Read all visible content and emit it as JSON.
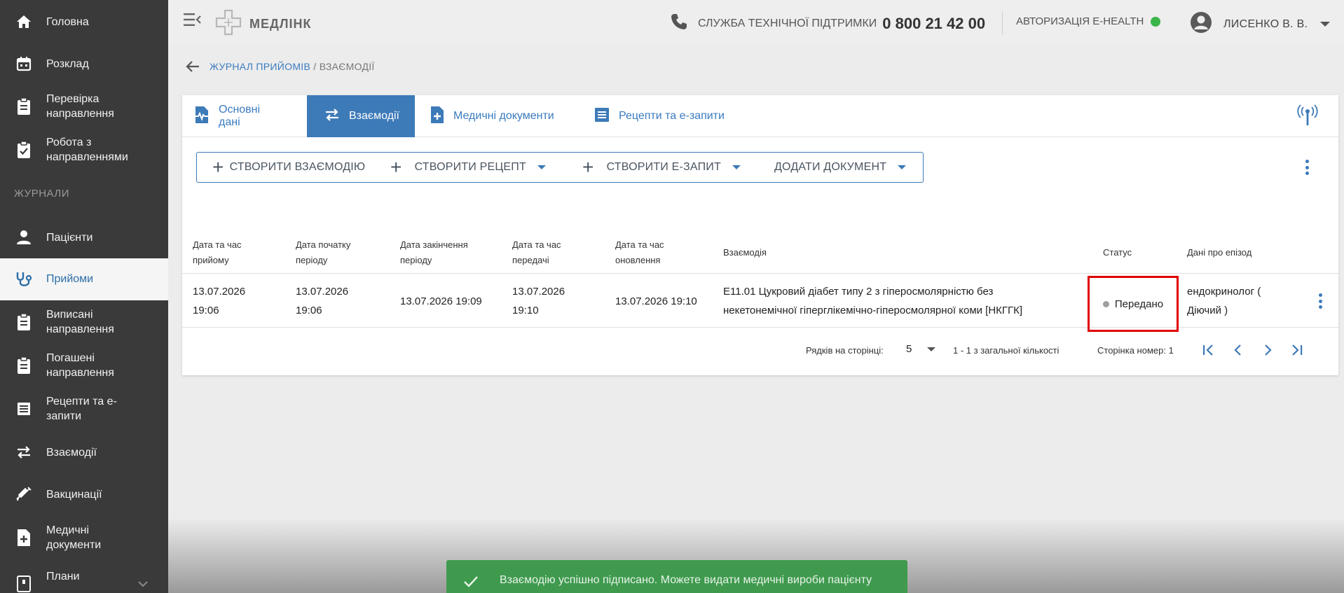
{
  "sidebar": {
    "items": [
      {
        "label": "Головна",
        "icon": "home-icon"
      },
      {
        "label": "Розклад",
        "icon": "calendar-icon"
      },
      {
        "label": "Перевірка\nнаправлення",
        "icon": "clipboard-icon"
      },
      {
        "label": "Робота з\nнаправленнями",
        "icon": "clipboard-check-icon"
      },
      {
        "label": "Пацієнти",
        "icon": "person-icon"
      },
      {
        "label": "Прийоми",
        "icon": "stethoscope-icon"
      },
      {
        "label": "Виписані\nнаправлення",
        "icon": "clipboard-icon"
      },
      {
        "label": "Погашені\nнаправлення",
        "icon": "clipboard-icon"
      },
      {
        "label": "Рецепти та е-\nзапити",
        "icon": "list-icon"
      },
      {
        "label": "Взаємодії",
        "icon": "swap-icon"
      },
      {
        "label": "Вакцинації",
        "icon": "syringe-icon"
      },
      {
        "label": "Медичні\nдокументи",
        "icon": "document-plus-icon"
      },
      {
        "label": "Плани",
        "icon": "plan-icon"
      }
    ],
    "section_label": "ЖУРНАЛИ"
  },
  "topbar": {
    "logo": "МЕДЛІНК",
    "support_label": "СЛУЖБА ТЕХНІЧНОЇ ПІДТРИМКИ",
    "support_phone": "0 800 21 42 00",
    "ehealth_label": "АВТОРИЗАЦІЯ E-HEALTH",
    "ehealth_status_color": "#3bb54a",
    "user_name": "ЛИСЕНКО В. В."
  },
  "breadcrumb": {
    "link": "ЖУРНАЛ ПРИЙОМІВ",
    "separator": " / ",
    "current": "ВЗАЄМОДІЇ"
  },
  "tabs": [
    {
      "label": "Основні дані",
      "icon": "pulse-icon"
    },
    {
      "label": "Взаємодії",
      "icon": "swap-icon"
    },
    {
      "label": "Медичні документи",
      "icon": "document-plus-icon"
    },
    {
      "label": "Рецепти та е-запити",
      "icon": "list-icon"
    }
  ],
  "actions": {
    "create_interaction": "СТВОРИТИ ВЗАЄМОДІЮ",
    "create_prescription": "СТВОРИТИ РЕЦЕПТ",
    "create_erequest": "СТВОРИТИ Е-ЗАПИТ",
    "add_document": "ДОДАТИ ДОКУМЕНТ"
  },
  "table": {
    "headers": [
      "Дата та час\nприйому",
      "Дата початку\nперіоду",
      "Дата закінчення\nперіоду",
      "Дата та час\nпередачі",
      "Дата та час\nоновлення",
      "Взаємодія",
      "Статус",
      "Дані про епізод"
    ],
    "rows": [
      {
        "appointment": "13.07.2026\n19:06",
        "period_start": "13.07.2026\n19:06",
        "period_end": "13.07.2026 19:09",
        "transferred": "13.07.2026\n19:10",
        "updated": "13.07.2026 19:10",
        "interaction": "E11.01 Цукровий діабет типу 2 з гіперосмолярністю без\nнекетонемічної гіперглікемічно-гіперосмолярної коми [НКГГК]",
        "status": "Передано",
        "episode": "ендокринолог (\nДіючий )"
      }
    ]
  },
  "pagination": {
    "rows_per_page_label": "Рядків на сторінці:",
    "rows_per_page": "5",
    "range": "1 - 1 з загальної кількості",
    "page_label": "Сторінка номер: 1"
  },
  "toast": {
    "message": "Взаємодію успішно підписано. Можете видати медичні вироби пацієнту"
  },
  "colors": {
    "sidebar": "#3a3a3a",
    "accent": "#3d7ab8",
    "highlight": "#e00000",
    "toast": "#3f9a4e"
  }
}
